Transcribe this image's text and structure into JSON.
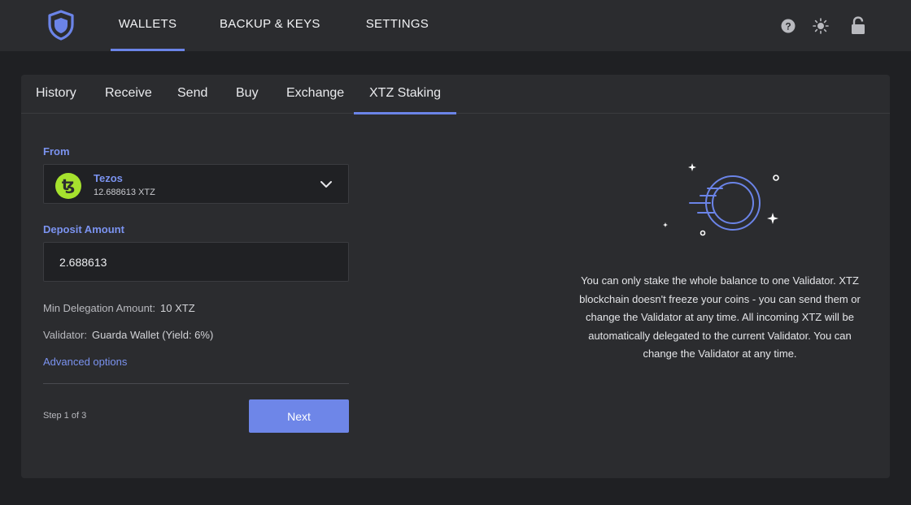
{
  "topnav": {
    "items": [
      {
        "label": "WALLETS",
        "active": true
      },
      {
        "label": "BACKUP & KEYS",
        "active": false
      },
      {
        "label": "SETTINGS",
        "active": false
      }
    ],
    "icons": [
      "help-icon",
      "theme-sun-icon",
      "lock-icon"
    ]
  },
  "subtabs": [
    {
      "label": "History"
    },
    {
      "label": "Receive"
    },
    {
      "label": "Send"
    },
    {
      "label": "Buy"
    },
    {
      "label": "Exchange"
    },
    {
      "label": "XTZ Staking",
      "active": true
    }
  ],
  "form": {
    "from_label": "From",
    "coin": {
      "symbol_glyph": "ꜩ",
      "name": "Tezos",
      "balance": "12.688613 XTZ"
    },
    "deposit_label": "Deposit Amount",
    "deposit_value": "2.688613",
    "min_delegation_label": "Min Delegation Amount:",
    "min_delegation_value": "10 XTZ",
    "validator_label": "Validator:",
    "validator_value": "Guarda Wallet (Yield: 6%)",
    "advanced_link": "Advanced options",
    "step_text": "Step 1 of 3",
    "next_label": "Next"
  },
  "info": {
    "text": "You can only stake the whole balance to one Validator. XTZ blockchain doesn't freeze your coins - you can send them or change the Validator at any time. All incoming XTZ will be automatically delegated to the current Validator. You can change the Validator at any time."
  },
  "colors": {
    "accent": "#6b84e8",
    "link": "#7b93f0",
    "tezos_icon_bg": "#a6e22e",
    "background": "#1f2023",
    "panel": "#2b2c2f"
  }
}
